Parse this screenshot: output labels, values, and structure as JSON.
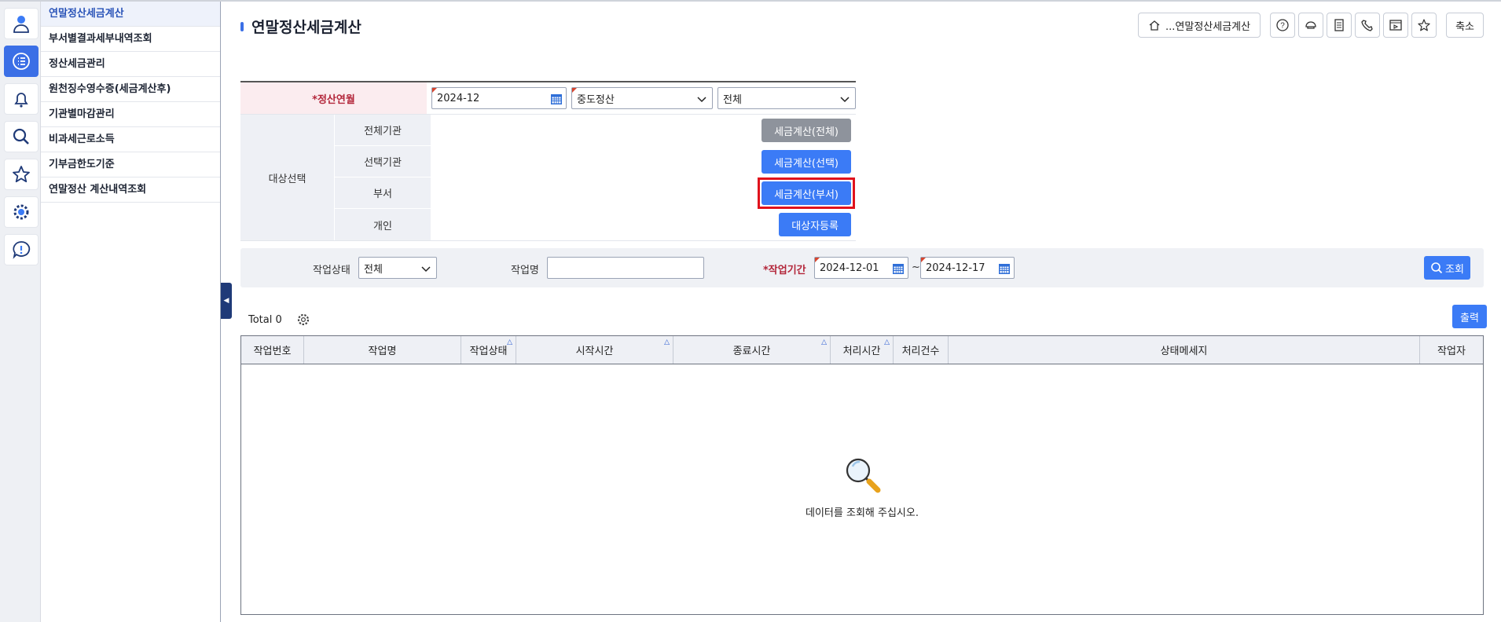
{
  "menu": {
    "items": [
      {
        "label": "연말정산세금계산"
      },
      {
        "label": "부서별결과세부내역조회"
      },
      {
        "label": "정산세금관리"
      },
      {
        "label": "원천징수영수증(세금계산후)"
      },
      {
        "label": "기관별마감관리"
      },
      {
        "label": "비과세근로소득"
      },
      {
        "label": "기부금한도기준"
      },
      {
        "label": "연말정산 계산내역조회"
      }
    ],
    "collapse_glyph": "◀"
  },
  "rail": [
    "user-icon",
    "list-icon",
    "bell-icon",
    "search-icon",
    "star-icon",
    "gear-icon",
    "alert-icon"
  ],
  "header": {
    "title": "연말정산세금계산",
    "breadcrumb": "...연말정산세금계산",
    "shrink_label": "축소"
  },
  "form": {
    "period_label": "*정산연월",
    "period_value": "2024-12",
    "type_value": "중도정산",
    "scope_value": "전체",
    "target_label": "대상선택",
    "rows": [
      {
        "label": "전체기관",
        "button": "세금계산(전체)"
      },
      {
        "label": "선택기관",
        "button": "세금계산(선택)"
      },
      {
        "label": "부서",
        "button": "세금계산(부서)"
      },
      {
        "label": "개인",
        "button": "대상자등록"
      }
    ]
  },
  "search": {
    "status_label": "작업상태",
    "status_value": "전체",
    "name_label": "작업명",
    "name_value": "",
    "period_label": "*작업기간",
    "date_from": "2024-12-01",
    "date_sep": "~",
    "date_to": "2024-12-17",
    "search_button": "조회"
  },
  "grid": {
    "total_label": "Total 0",
    "print_button": "출력",
    "columns": [
      {
        "label": "작업번호",
        "sortable": false
      },
      {
        "label": "작업명",
        "sortable": false
      },
      {
        "label": "작업상태",
        "sortable": true
      },
      {
        "label": "시작시간",
        "sortable": true
      },
      {
        "label": "종료시간",
        "sortable": true
      },
      {
        "label": "처리시간",
        "sortable": true
      },
      {
        "label": "처리건수",
        "sortable": false
      },
      {
        "label": "상태메세지",
        "sortable": false
      },
      {
        "label": "작업자",
        "sortable": false
      }
    ],
    "empty_message": "데이터를 조회해 주십시오."
  },
  "colors": {
    "accent": "#3b7bf6",
    "highlight": "#e0121c",
    "required": "#b3263a"
  }
}
